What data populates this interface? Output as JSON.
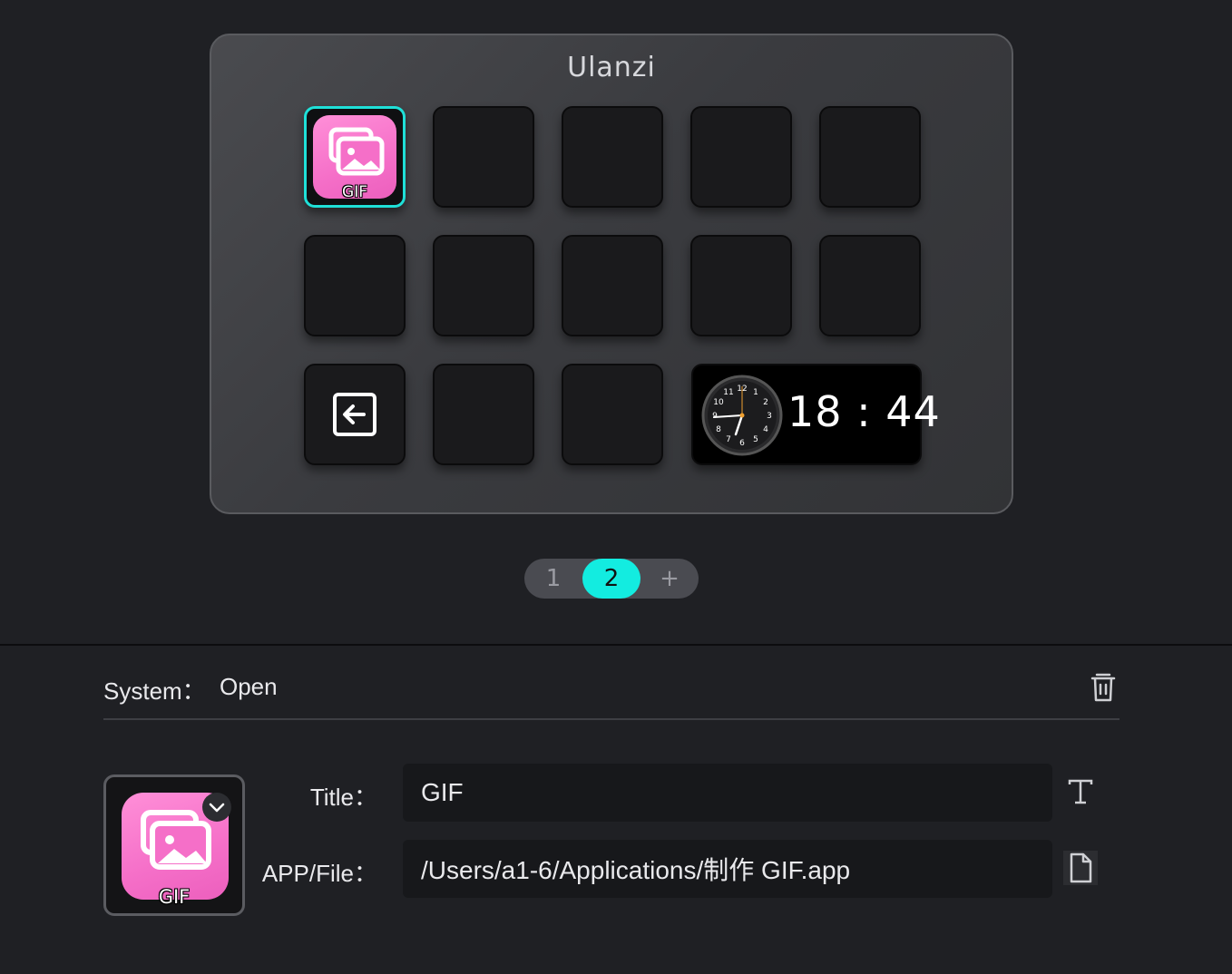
{
  "device": {
    "brand": "Ulanzi",
    "keys": [
      {
        "row": 0,
        "col": 0,
        "type": "gif",
        "label": "GIF",
        "selected": true
      },
      {
        "row": 2,
        "col": 0,
        "type": "back-icon"
      },
      {
        "type": "clock",
        "time": "18 : 44",
        "dial_numbers": [
          "12",
          "1",
          "2",
          "3",
          "4",
          "5",
          "6",
          "7",
          "8",
          "9",
          "10",
          "11"
        ]
      }
    ]
  },
  "pager": {
    "pages": [
      "1",
      "2"
    ],
    "active": "2",
    "add_label": "+"
  },
  "system": {
    "label": "System：",
    "value": "Open"
  },
  "preview": {
    "label": "GIF"
  },
  "form": {
    "title_label": "Title：",
    "title_value": "GIF",
    "file_label": "APP/File：",
    "file_value": "/Users/a1-6/Applications/制作 GIF.app"
  },
  "colors": {
    "accent": "#13ece0",
    "background": "#1f2024",
    "gif_pink": "#f56fc8"
  }
}
